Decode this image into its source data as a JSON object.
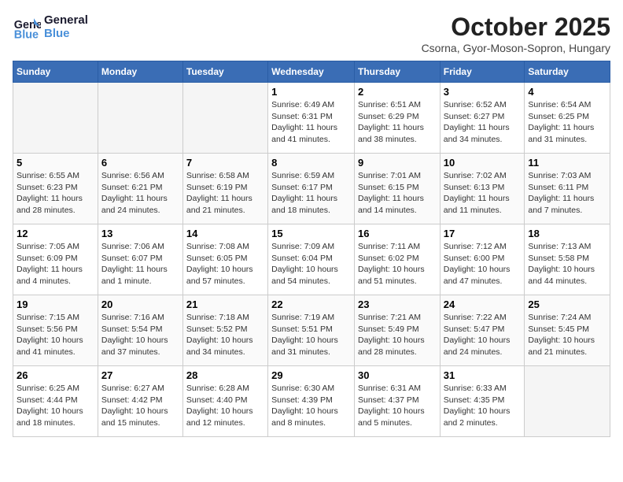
{
  "header": {
    "logo_line1": "General",
    "logo_line2": "Blue",
    "month": "October 2025",
    "location": "Csorna, Gyor-Moson-Sopron, Hungary"
  },
  "weekdays": [
    "Sunday",
    "Monday",
    "Tuesday",
    "Wednesday",
    "Thursday",
    "Friday",
    "Saturday"
  ],
  "weeks": [
    [
      {
        "day": "",
        "info": ""
      },
      {
        "day": "",
        "info": ""
      },
      {
        "day": "",
        "info": ""
      },
      {
        "day": "1",
        "info": "Sunrise: 6:49 AM\nSunset: 6:31 PM\nDaylight: 11 hours\nand 41 minutes."
      },
      {
        "day": "2",
        "info": "Sunrise: 6:51 AM\nSunset: 6:29 PM\nDaylight: 11 hours\nand 38 minutes."
      },
      {
        "day": "3",
        "info": "Sunrise: 6:52 AM\nSunset: 6:27 PM\nDaylight: 11 hours\nand 34 minutes."
      },
      {
        "day": "4",
        "info": "Sunrise: 6:54 AM\nSunset: 6:25 PM\nDaylight: 11 hours\nand 31 minutes."
      }
    ],
    [
      {
        "day": "5",
        "info": "Sunrise: 6:55 AM\nSunset: 6:23 PM\nDaylight: 11 hours\nand 28 minutes."
      },
      {
        "day": "6",
        "info": "Sunrise: 6:56 AM\nSunset: 6:21 PM\nDaylight: 11 hours\nand 24 minutes."
      },
      {
        "day": "7",
        "info": "Sunrise: 6:58 AM\nSunset: 6:19 PM\nDaylight: 11 hours\nand 21 minutes."
      },
      {
        "day": "8",
        "info": "Sunrise: 6:59 AM\nSunset: 6:17 PM\nDaylight: 11 hours\nand 18 minutes."
      },
      {
        "day": "9",
        "info": "Sunrise: 7:01 AM\nSunset: 6:15 PM\nDaylight: 11 hours\nand 14 minutes."
      },
      {
        "day": "10",
        "info": "Sunrise: 7:02 AM\nSunset: 6:13 PM\nDaylight: 11 hours\nand 11 minutes."
      },
      {
        "day": "11",
        "info": "Sunrise: 7:03 AM\nSunset: 6:11 PM\nDaylight: 11 hours\nand 7 minutes."
      }
    ],
    [
      {
        "day": "12",
        "info": "Sunrise: 7:05 AM\nSunset: 6:09 PM\nDaylight: 11 hours\nand 4 minutes."
      },
      {
        "day": "13",
        "info": "Sunrise: 7:06 AM\nSunset: 6:07 PM\nDaylight: 11 hours\nand 1 minute."
      },
      {
        "day": "14",
        "info": "Sunrise: 7:08 AM\nSunset: 6:05 PM\nDaylight: 10 hours\nand 57 minutes."
      },
      {
        "day": "15",
        "info": "Sunrise: 7:09 AM\nSunset: 6:04 PM\nDaylight: 10 hours\nand 54 minutes."
      },
      {
        "day": "16",
        "info": "Sunrise: 7:11 AM\nSunset: 6:02 PM\nDaylight: 10 hours\nand 51 minutes."
      },
      {
        "day": "17",
        "info": "Sunrise: 7:12 AM\nSunset: 6:00 PM\nDaylight: 10 hours\nand 47 minutes."
      },
      {
        "day": "18",
        "info": "Sunrise: 7:13 AM\nSunset: 5:58 PM\nDaylight: 10 hours\nand 44 minutes."
      }
    ],
    [
      {
        "day": "19",
        "info": "Sunrise: 7:15 AM\nSunset: 5:56 PM\nDaylight: 10 hours\nand 41 minutes."
      },
      {
        "day": "20",
        "info": "Sunrise: 7:16 AM\nSunset: 5:54 PM\nDaylight: 10 hours\nand 37 minutes."
      },
      {
        "day": "21",
        "info": "Sunrise: 7:18 AM\nSunset: 5:52 PM\nDaylight: 10 hours\nand 34 minutes."
      },
      {
        "day": "22",
        "info": "Sunrise: 7:19 AM\nSunset: 5:51 PM\nDaylight: 10 hours\nand 31 minutes."
      },
      {
        "day": "23",
        "info": "Sunrise: 7:21 AM\nSunset: 5:49 PM\nDaylight: 10 hours\nand 28 minutes."
      },
      {
        "day": "24",
        "info": "Sunrise: 7:22 AM\nSunset: 5:47 PM\nDaylight: 10 hours\nand 24 minutes."
      },
      {
        "day": "25",
        "info": "Sunrise: 7:24 AM\nSunset: 5:45 PM\nDaylight: 10 hours\nand 21 minutes."
      }
    ],
    [
      {
        "day": "26",
        "info": "Sunrise: 6:25 AM\nSunset: 4:44 PM\nDaylight: 10 hours\nand 18 minutes."
      },
      {
        "day": "27",
        "info": "Sunrise: 6:27 AM\nSunset: 4:42 PM\nDaylight: 10 hours\nand 15 minutes."
      },
      {
        "day": "28",
        "info": "Sunrise: 6:28 AM\nSunset: 4:40 PM\nDaylight: 10 hours\nand 12 minutes."
      },
      {
        "day": "29",
        "info": "Sunrise: 6:30 AM\nSunset: 4:39 PM\nDaylight: 10 hours\nand 8 minutes."
      },
      {
        "day": "30",
        "info": "Sunrise: 6:31 AM\nSunset: 4:37 PM\nDaylight: 10 hours\nand 5 minutes."
      },
      {
        "day": "31",
        "info": "Sunrise: 6:33 AM\nSunset: 4:35 PM\nDaylight: 10 hours\nand 2 minutes."
      },
      {
        "day": "",
        "info": ""
      }
    ]
  ]
}
